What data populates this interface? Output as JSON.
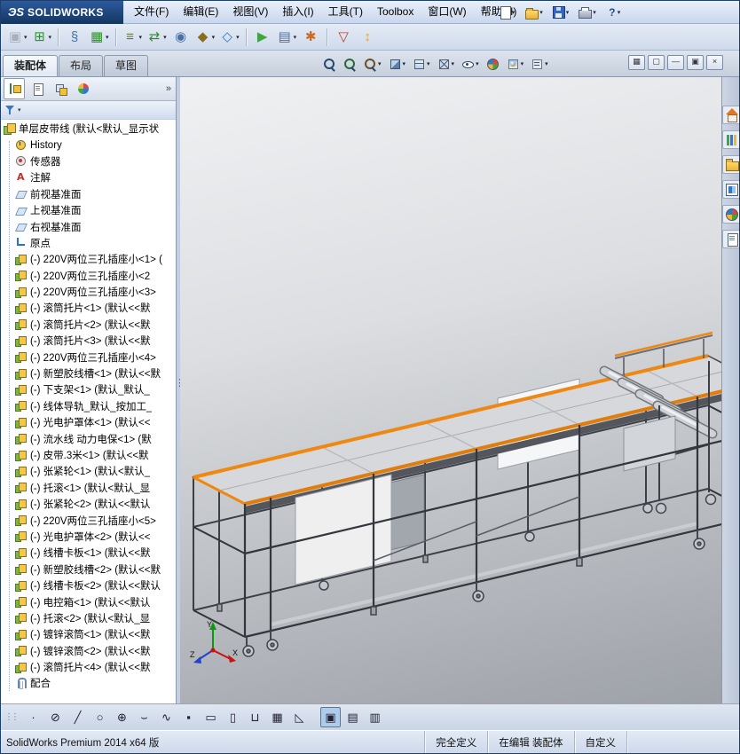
{
  "titlebar": {
    "logo_mark": "ЭS",
    "logo_text": "SOLIDWORKS",
    "buttons": [
      {
        "name": "new-document",
        "kind": "new",
        "dropdown": true
      },
      {
        "name": "open-document",
        "kind": "open",
        "dropdown": true
      },
      {
        "name": "save-document",
        "kind": "save",
        "dropdown": true
      },
      {
        "name": "print-document",
        "kind": "print",
        "dropdown": true
      },
      {
        "name": "help",
        "kind": "help",
        "dropdown": true
      }
    ]
  },
  "menu": {
    "items": [
      "文件(F)",
      "编辑(E)",
      "视图(V)",
      "插入(I)",
      "工具(T)",
      "Toolbox",
      "窗口(W)",
      "帮助(H)"
    ]
  },
  "main_toolbar": {
    "buttons": [
      {
        "name": "edit-component",
        "glyph": "▣",
        "color": "#9aa2ae",
        "dropdown": true,
        "disabled": true
      },
      {
        "name": "insert-components",
        "glyph": "⊞",
        "color": "#2f8f2f",
        "dropdown": true
      },
      {
        "sep": true
      },
      {
        "name": "mate",
        "glyph": "§",
        "color": "#4a6fa5"
      },
      {
        "name": "linear-component-pattern",
        "glyph": "▦",
        "color": "#2f8f2f",
        "dropdown": true
      },
      {
        "sep": true
      },
      {
        "name": "smart-fasteners",
        "glyph": "≡",
        "color": "#6a7a3f",
        "dropdown": true
      },
      {
        "name": "move-component",
        "glyph": "⇄",
        "color": "#2f8f2f",
        "dropdown": true
      },
      {
        "name": "show-hidden-components",
        "glyph": "◉",
        "color": "#4a6fa5"
      },
      {
        "name": "assembly-features",
        "glyph": "◆",
        "color": "#8a6d1f",
        "dropdown": true
      },
      {
        "name": "reference-geometry",
        "glyph": "◇",
        "color": "#2a7ad4",
        "dropdown": true
      },
      {
        "sep": true
      },
      {
        "name": "new-motion-study",
        "glyph": "▶",
        "color": "#3fa53f"
      },
      {
        "name": "bill-of-materials",
        "glyph": "▤",
        "color": "#4a6fa5",
        "dropdown": true
      },
      {
        "name": "exploded-view",
        "glyph": "✱",
        "color": "#d26a1e"
      },
      {
        "sep": true
      },
      {
        "name": "interference-detection",
        "glyph": "▽",
        "color": "#b8442c"
      },
      {
        "name": "instant3d",
        "glyph": "↕",
        "color": "#e8a020"
      }
    ]
  },
  "tabs": {
    "items": [
      {
        "name": "tab-assembly",
        "label": "装配体",
        "active": true
      },
      {
        "name": "tab-layout",
        "label": "布局",
        "active": false
      },
      {
        "name": "tab-sketch",
        "label": "草图",
        "active": false
      }
    ]
  },
  "headsup": {
    "buttons": [
      {
        "name": "zoom-to-fit",
        "kind": "mag"
      },
      {
        "name": "zoom-to-area",
        "kind": "magplus"
      },
      {
        "name": "previous-view",
        "kind": "magprev",
        "dropdown": true
      },
      {
        "name": "section-view",
        "kind": "section",
        "dropdown": true
      },
      {
        "name": "view-orientation",
        "kind": "cube",
        "dropdown": true
      },
      {
        "name": "display-style",
        "kind": "cubewire",
        "dropdown": true
      },
      {
        "name": "hide-show-items",
        "kind": "eye",
        "dropdown": true
      },
      {
        "name": "edit-appearance",
        "kind": "sphere"
      },
      {
        "name": "apply-scene",
        "kind": "scene",
        "dropdown": true
      },
      {
        "name": "view-settings",
        "kind": "settings",
        "dropdown": true
      }
    ]
  },
  "window_buttons": [
    {
      "name": "window-new",
      "glyph": "▦"
    },
    {
      "name": "window-cascade",
      "glyph": "▢"
    },
    {
      "name": "window-minimize",
      "glyph": "—"
    },
    {
      "name": "window-restore",
      "glyph": "▣"
    },
    {
      "name": "window-close",
      "glyph": "×"
    }
  ],
  "feature_panel": {
    "tabs": [
      {
        "name": "featuremanager-tab",
        "kind": "tree",
        "active": true
      },
      {
        "name": "propertymanager-tab",
        "kind": "props",
        "active": false
      },
      {
        "name": "configurationmanager-tab",
        "kind": "config",
        "active": false
      },
      {
        "name": "displaymanager-tab",
        "kind": "display",
        "active": false
      }
    ],
    "overflow_label": "»"
  },
  "tree": {
    "root": {
      "label": "单层皮带线 (默认<默认_显示状"
    },
    "items": [
      {
        "type": "history",
        "label": "History"
      },
      {
        "type": "sensor",
        "label": "传感器"
      },
      {
        "type": "annotation",
        "label": "注解"
      },
      {
        "type": "plane",
        "label": "前视基准面"
      },
      {
        "type": "plane",
        "label": "上视基准面"
      },
      {
        "type": "plane",
        "label": "右视基准面"
      },
      {
        "type": "origin",
        "label": "原点"
      },
      {
        "type": "part",
        "label": "(-) 220V两位三孔插座小<1> ("
      },
      {
        "type": "part",
        "label": "(-) 220V两位三孔插座小<2"
      },
      {
        "type": "part",
        "label": "(-) 220V两位三孔插座小<3>"
      },
      {
        "type": "part",
        "label": "(-) 滚筒托片<1> (默认<<默"
      },
      {
        "type": "part",
        "label": "(-) 滚筒托片<2> (默认<<默"
      },
      {
        "type": "part",
        "label": "(-) 滚筒托片<3> (默认<<默"
      },
      {
        "type": "part",
        "label": "(-) 220V两位三孔插座小<4>"
      },
      {
        "type": "part",
        "label": "(-) 新塑胶线槽<1> (默认<<默"
      },
      {
        "type": "part",
        "label": "(-) 下支架<1> (默认_默认_"
      },
      {
        "type": "part",
        "label": "(-) 线体导轨_默认_按加工_"
      },
      {
        "type": "part",
        "label": "(-) 光电护罩体<1> (默认<<"
      },
      {
        "type": "part",
        "label": "(-) 流水线 动力电保<1> (默"
      },
      {
        "type": "part",
        "label": "(-) 皮带.3米<1> (默认<<默"
      },
      {
        "type": "part",
        "label": "(-) 张紧轮<1> (默认<默认_"
      },
      {
        "type": "part",
        "label": "(-) 托滚<1> (默认<默认_显"
      },
      {
        "type": "part",
        "label": "(-) 张紧轮<2> (默认<<默认"
      },
      {
        "type": "part",
        "label": "(-) 220V两位三孔插座小<5>"
      },
      {
        "type": "part",
        "label": "(-) 光电护罩体<2> (默认<<"
      },
      {
        "type": "part",
        "label": "(-) 线槽卡板<1> (默认<<默"
      },
      {
        "type": "part",
        "label": "(-) 新塑胶线槽<2> (默认<<默"
      },
      {
        "type": "part",
        "label": "(-) 线槽卡板<2> (默认<<默认"
      },
      {
        "type": "part",
        "label": "(-) 电控箱<1> (默认<<默认"
      },
      {
        "type": "part",
        "label": "(-) 托滚<2> (默认<默认_显"
      },
      {
        "type": "part",
        "label": "(-) 镀锌滚筒<1> (默认<<默"
      },
      {
        "type": "part",
        "label": "(-) 镀锌滚筒<2> (默认<<默"
      },
      {
        "type": "part",
        "label": "(-) 滚筒托片<4> (默认<<默"
      },
      {
        "type": "mates",
        "label": "配合"
      }
    ]
  },
  "task_pane": {
    "icons": [
      {
        "name": "solidworks-resources",
        "kind": "house"
      },
      {
        "name": "design-library",
        "kind": "library"
      },
      {
        "name": "file-explorer",
        "kind": "folder"
      },
      {
        "name": "view-palette",
        "kind": "palette"
      },
      {
        "name": "appearances-scenes",
        "kind": "sphere"
      },
      {
        "name": "custom-properties",
        "kind": "props"
      }
    ]
  },
  "sketch_toolbar": {
    "buttons": [
      {
        "name": "select-tool",
        "glyph": "·"
      },
      {
        "name": "slot-tool",
        "glyph": "⊘"
      },
      {
        "name": "line-tool",
        "glyph": "╱"
      },
      {
        "name": "circle-tool",
        "glyph": "○"
      },
      {
        "name": "perimeter-circle-tool",
        "glyph": "⊕"
      },
      {
        "name": "arc-tool",
        "glyph": "⌣"
      },
      {
        "name": "spline-tool",
        "glyph": "∿"
      },
      {
        "name": "point-tool",
        "glyph": "▪"
      },
      {
        "name": "rectangle-tool",
        "glyph": "▭"
      },
      {
        "name": "parallelogram-tool",
        "glyph": "▯"
      },
      {
        "name": "straight-slot-tool",
        "glyph": "⊔"
      },
      {
        "name": "grid-pattern-tool",
        "glyph": "▦"
      },
      {
        "name": "chamfer-tool",
        "glyph": "◺"
      },
      {
        "sep": true
      },
      {
        "name": "sketch-toggle",
        "glyph": "▣",
        "active": true
      },
      {
        "name": "design-table-tool",
        "glyph": "▤"
      },
      {
        "name": "evaluate-table-tool",
        "glyph": "▥"
      }
    ]
  },
  "status": {
    "product": "SolidWorks Premium 2014 x64 版",
    "defined": "完全定义",
    "editing": "在编辑 装配体",
    "custom": "自定义"
  },
  "viewport": {
    "triad": {
      "x_label": "X",
      "y_label": "Y",
      "z_label": "Z"
    }
  },
  "colors": {
    "accent_orange": "#ee8511",
    "titlebar_blue": "#1c3f6e",
    "viewport_top": "#f0f1f3",
    "viewport_bottom": "#9da1a8"
  }
}
